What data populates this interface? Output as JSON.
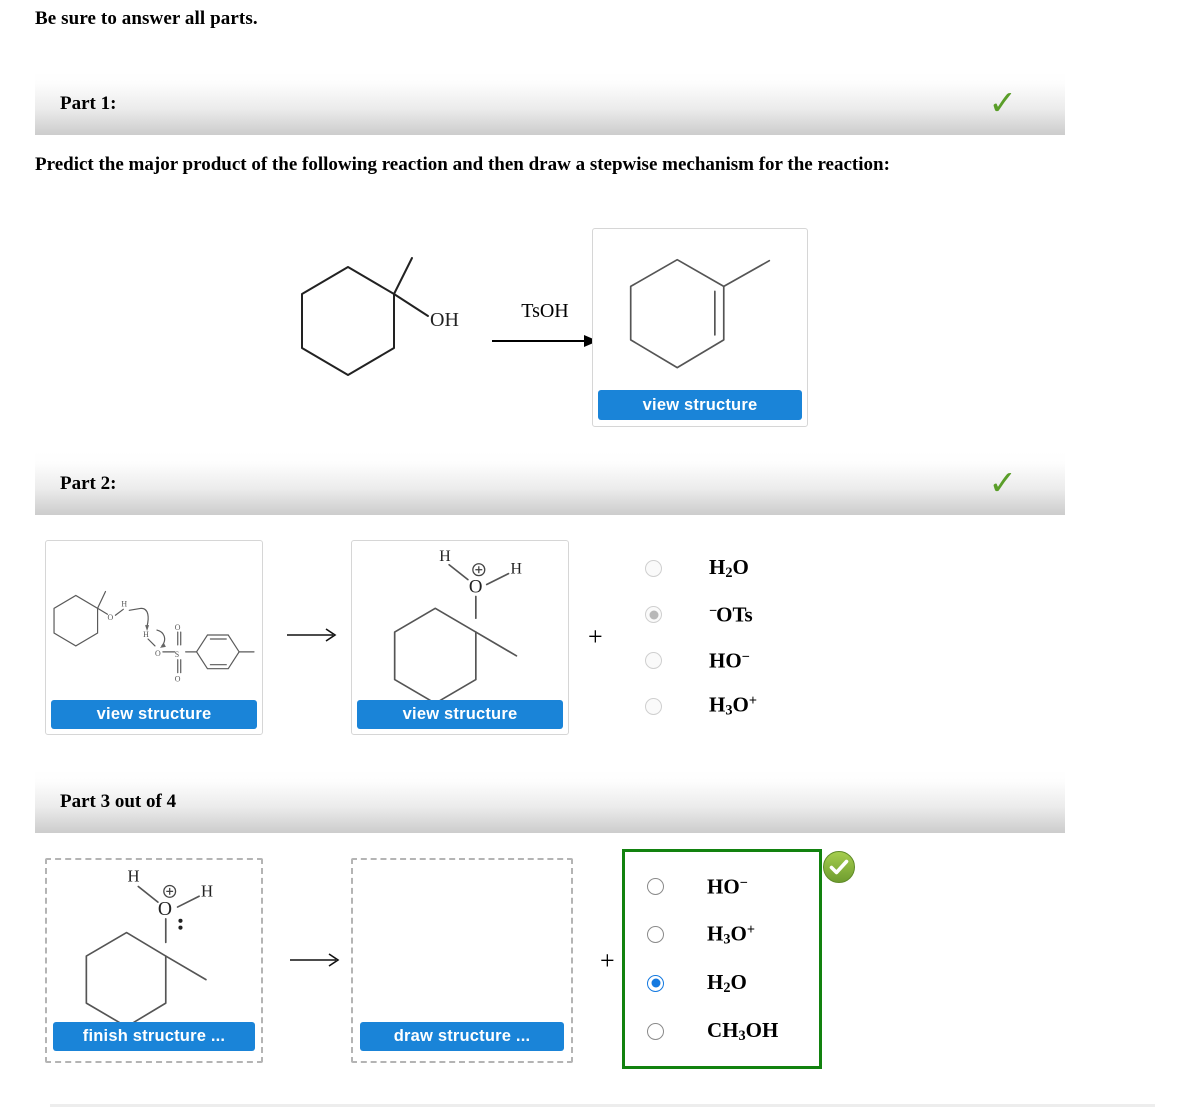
{
  "instruction": "Be sure to answer all parts.",
  "prompt": "Predict the major product of the following reaction and then draw a stepwise mechanism for the reaction:",
  "part1": {
    "label": "Part 1:",
    "status_icon": "check-mark",
    "status_glyph": "✓",
    "reagent": "TsOH",
    "product_button": "view structure"
  },
  "part2": {
    "label": "Part 2:",
    "status_icon": "check-mark",
    "status_glyph": "✓",
    "left_button": "view structure",
    "right_button": "view structure",
    "plus": "+",
    "arrow": "⟶",
    "options": [
      {
        "html": "H<sub>2</sub>O",
        "selected": false
      },
      {
        "html": "<span class=\"pre-sup\">−</span>OTs",
        "selected": true
      },
      {
        "html": "HO<sup>−</sup>",
        "selected": false
      },
      {
        "html": "H<sub>3</sub>O<sup>+</sup>",
        "selected": false
      }
    ]
  },
  "part3": {
    "label": "Part 3 out of 4",
    "status_icon": "check-badge",
    "left_button": "finish structure ...",
    "right_button": "draw structure ...",
    "plus": "+",
    "arrow": "⟶",
    "options": [
      {
        "html": "HO<sup>−</sup>",
        "selected": false
      },
      {
        "html": "H<sub>3</sub>O<sup>+</sup>",
        "selected": false
      },
      {
        "html": "H<sub>2</sub>O",
        "selected": true
      },
      {
        "html": "CH<sub>3</sub>OH",
        "selected": false
      }
    ]
  },
  "colors": {
    "button_blue": "#1a84d8",
    "check_green": "#5a9e29",
    "badge_green": "#8bc34a",
    "correct_border_green": "#12820f",
    "radio_selected_blue": "#1479e0"
  }
}
